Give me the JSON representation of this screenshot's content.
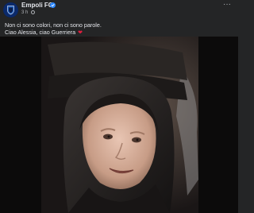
{
  "post": {
    "page_name": "Empoli FC",
    "timestamp": "3 h",
    "more_label": "···",
    "caption_line1": "Non ci sono colori, non ci sono parole.",
    "caption_line2": "Ciao Alessia, ciao Guerriera",
    "heart_glyph": "❤"
  },
  "icons": {
    "avatar": "empoli-logo-icon",
    "verified": "verified-badge-icon",
    "audience": "globe-icon",
    "more": "more-options-icon"
  },
  "colors": {
    "background": "#242526",
    "text_primary": "#e4e6eb",
    "text_secondary": "#b0b3b8",
    "verified_blue": "#2d88ff",
    "heart_red": "#e41e3f"
  }
}
